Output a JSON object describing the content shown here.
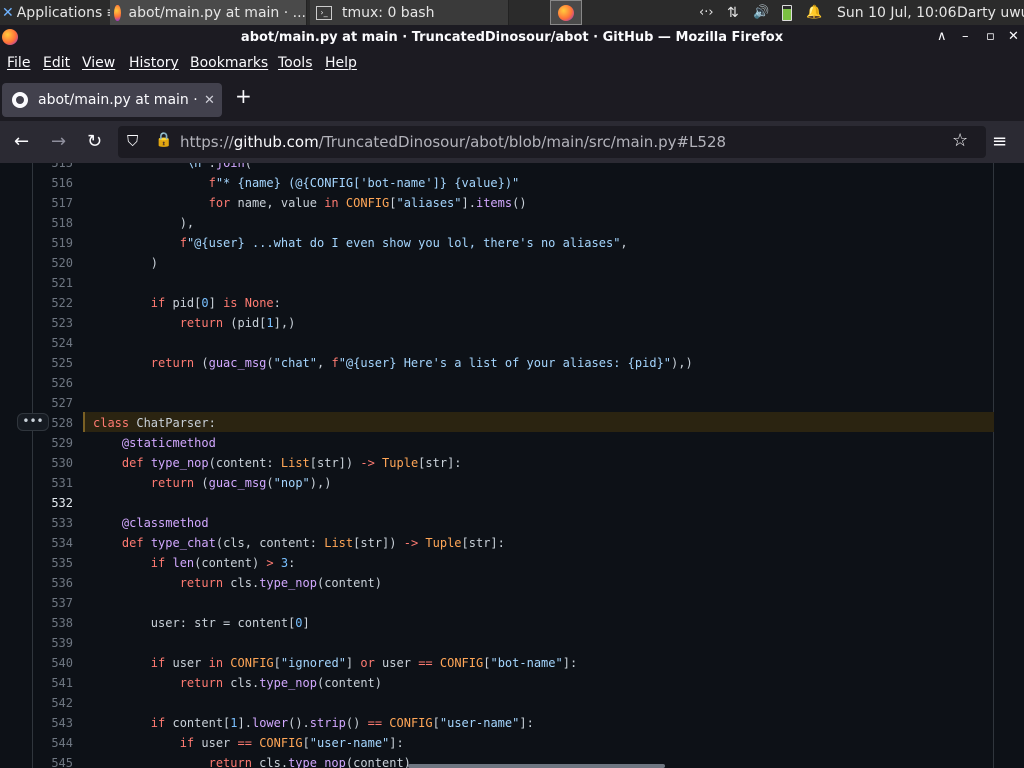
{
  "taskbar": {
    "applications": "Applications",
    "sep": "≡",
    "window1": "abot/main.py at main · ...",
    "window2": "tmux: 0 bash",
    "network": "‹·›",
    "datetime": "Sun 10 Jul, 10:06",
    "user": "Darty uwu"
  },
  "browser": {
    "window_title": "abot/main.py at main · TruncatedDinosour/abot · GitHub — Mozilla Firefox",
    "menu": [
      "File",
      "Edit",
      "View",
      "History",
      "Bookmarks",
      "Tools",
      "Help"
    ],
    "tab_title": "abot/main.py at main · Tr",
    "new_tab": "+",
    "url_scheme": "https://",
    "url_host": "github.com",
    "url_path": "/TruncatedDinosour/abot/blob/main/src/main.py#L528"
  },
  "code": {
    "expand_button": "•••",
    "current_line": 532,
    "highlighted_line": 528,
    "lines": [
      {
        "n": "515",
        "t": "            \"\\n\".join("
      },
      {
        "n": "516",
        "t": "                f\"* {name} (@{CONFIG['bot-name']} {value})\""
      },
      {
        "n": "517",
        "t": "                for name, value in CONFIG[\"aliases\"].items()"
      },
      {
        "n": "518",
        "t": "            ),"
      },
      {
        "n": "519",
        "t": "            f\"@{user} ...what do I even show you lol, there's no aliases\","
      },
      {
        "n": "520",
        "t": "        )"
      },
      {
        "n": "521",
        "t": ""
      },
      {
        "n": "522",
        "t": "        if pid[0] is None:"
      },
      {
        "n": "523",
        "t": "            return (pid[1],)"
      },
      {
        "n": "524",
        "t": ""
      },
      {
        "n": "525",
        "t": "        return (guac_msg(\"chat\", f\"@{user} Here's a list of your aliases: {pid}\"),)"
      },
      {
        "n": "526",
        "t": ""
      },
      {
        "n": "527",
        "t": ""
      },
      {
        "n": "528",
        "t": "class ChatParser:"
      },
      {
        "n": "529",
        "t": "    @staticmethod"
      },
      {
        "n": "530",
        "t": "    def type_nop(content: List[str]) -> Tuple[str]:"
      },
      {
        "n": "531",
        "t": "        return (guac_msg(\"nop\"),)"
      },
      {
        "n": "532",
        "t": ""
      },
      {
        "n": "533",
        "t": "    @classmethod"
      },
      {
        "n": "534",
        "t": "    def type_chat(cls, content: List[str]) -> Tuple[str]:"
      },
      {
        "n": "535",
        "t": "        if len(content) > 3:"
      },
      {
        "n": "536",
        "t": "            return cls.type_nop(content)"
      },
      {
        "n": "537",
        "t": ""
      },
      {
        "n": "538",
        "t": "        user: str = content[0]"
      },
      {
        "n": "539",
        "t": ""
      },
      {
        "n": "540",
        "t": "        if user in CONFIG[\"ignored\"] or user == CONFIG[\"bot-name\"]:"
      },
      {
        "n": "541",
        "t": "            return cls.type_nop(content)"
      },
      {
        "n": "542",
        "t": ""
      },
      {
        "n": "543",
        "t": "        if content[1].lower().strip() == CONFIG[\"user-name\"]:"
      },
      {
        "n": "544",
        "t": "            if user == CONFIG[\"user-name\"]:"
      },
      {
        "n": "545",
        "t": "                return cls.type_nop(content)"
      }
    ]
  }
}
